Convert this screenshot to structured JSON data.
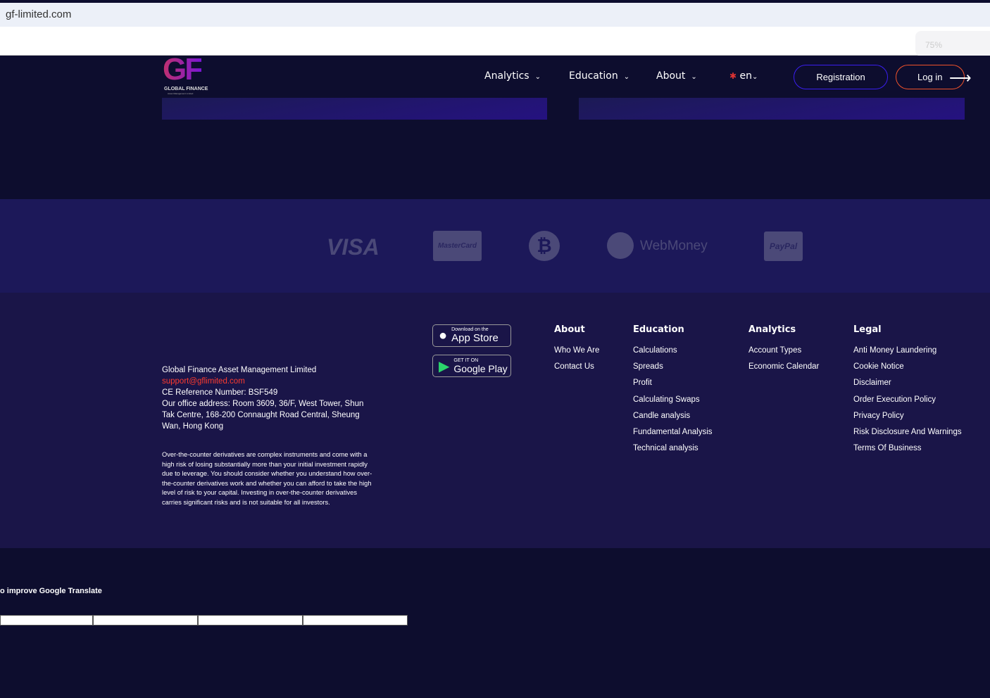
{
  "browser": {
    "url": "gf-limited.com",
    "zoom": "75%"
  },
  "logo": {
    "mark": "GF",
    "name": "GLOBAL FINANCE",
    "sub": "Asset Management Limited"
  },
  "nav": {
    "items": [
      {
        "label": "Analytics"
      },
      {
        "label": "Education"
      },
      {
        "label": "About"
      }
    ],
    "lang": "en",
    "registration": "Registration",
    "login": "Log in"
  },
  "payments": [
    "VISA",
    "MasterCard",
    "WebMoney",
    "PayPal"
  ],
  "footer": {
    "company": "Global Finance Asset Management Limited",
    "email": "support@gflimited.com",
    "ce_ref": "CE Reference Number: BSF549",
    "address": "Our office address: Room 3609, 36/F, West Tower, Shun Tak Centre, 168-200 Connaught Road Central, Sheung Wan, Hong Kong",
    "risk": "Over-the-counter derivatives are complex instruments and come with a high risk of losing substantially more than your initial investment rapidly due to leverage. You should consider whether you understand how over-the-counter derivatives work and whether you can afford to take the high level of risk to your capital. Investing in over-the-counter derivatives carries significant risks and is not suitable for all investors.",
    "appstore": {
      "small": "Download on the",
      "big": "App Store"
    },
    "googleplay": {
      "small": "GET IT ON",
      "big": "Google Play"
    },
    "columns": [
      {
        "title": "About",
        "links": [
          "Who We Are",
          "Contact Us"
        ]
      },
      {
        "title": "Education",
        "links": [
          "Calculations",
          "Spreads",
          "Profit",
          "Calculating Swaps",
          "Candle analysis",
          "Fundamental Analysis",
          "Technical analysis"
        ]
      },
      {
        "title": "Analytics",
        "links": [
          "Account Types",
          "Economic Calendar"
        ]
      },
      {
        "title": "Legal",
        "links": [
          "Anti Money Laundering",
          "Cookie Notice",
          "Disclaimer",
          "Order Execution Policy",
          "Privacy Policy",
          "Risk Disclosure And Warnings",
          "Terms Of Business"
        ]
      }
    ]
  },
  "translate": {
    "text": "o improve Google Translate"
  },
  "colors": {
    "accent_red": "#ff3b2f",
    "reg_border": "#3a1ef0",
    "login_border": "#f0522a"
  }
}
